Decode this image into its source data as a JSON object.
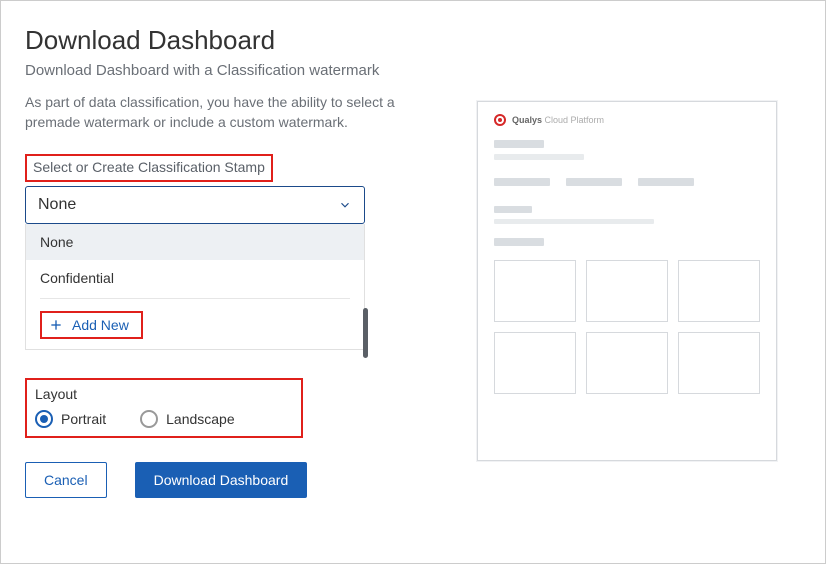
{
  "title": "Download Dashboard",
  "subtitle": "Download Dashboard with a Classification watermark",
  "description": "As part of data classification, you have the ability to select a premade watermark or include a custom watermark.",
  "stamp": {
    "label": "Select or Create Classification Stamp",
    "selected": "None",
    "options": [
      "None",
      "Confidential"
    ],
    "add_new": "Add New"
  },
  "layout": {
    "label": "Layout",
    "options": [
      "Portrait",
      "Landscape"
    ],
    "selected": "Portrait"
  },
  "buttons": {
    "cancel": "Cancel",
    "download": "Download Dashboard"
  },
  "preview": {
    "brand": "Qualys",
    "brand_sub": "Cloud Platform"
  }
}
